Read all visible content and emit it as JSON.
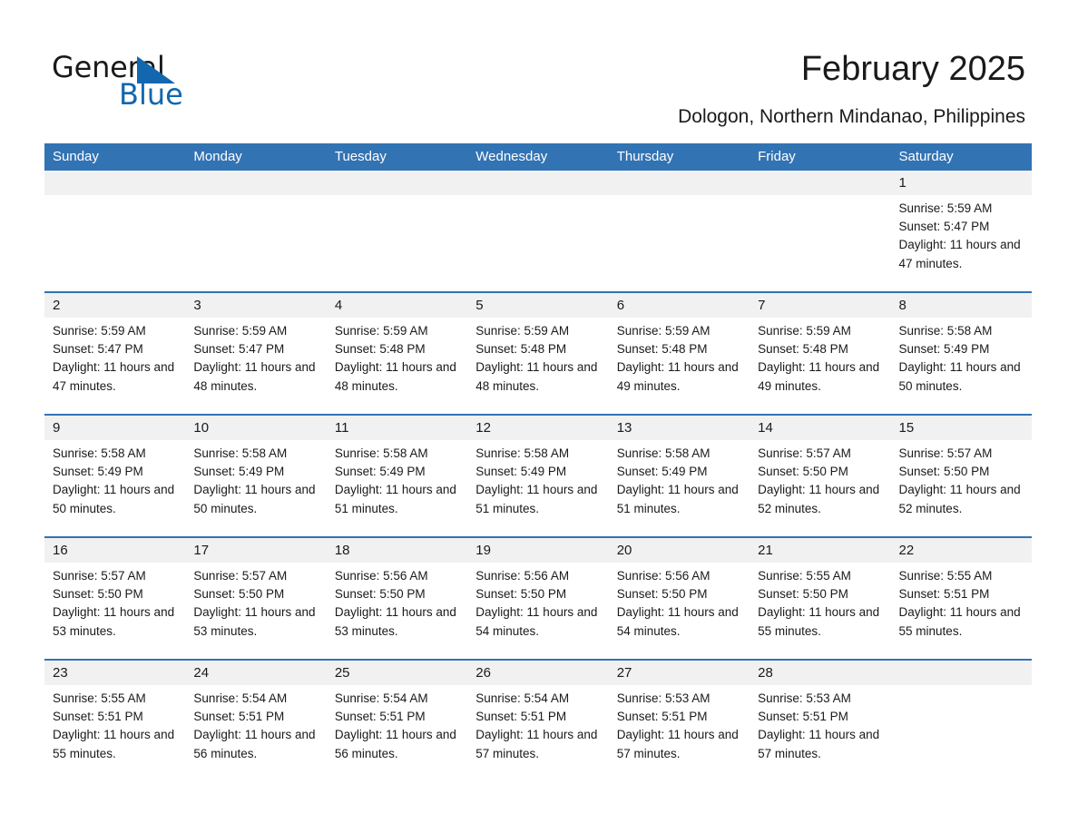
{
  "brand": {
    "name_part1": "General",
    "name_part2": "Blue",
    "accent_color": "#1267ae",
    "logo_icon": "triangle-flag-icon"
  },
  "header": {
    "title": "February 2025",
    "subtitle": "Dologon, Northern Mindanao, Philippines"
  },
  "calendar": {
    "header_bg": "#3273b4",
    "daynum_bg": "#f1f1f1",
    "weekdays": [
      "Sunday",
      "Monday",
      "Tuesday",
      "Wednesday",
      "Thursday",
      "Friday",
      "Saturday"
    ],
    "weeks": [
      [
        {
          "day": "",
          "empty": true
        },
        {
          "day": "",
          "empty": true
        },
        {
          "day": "",
          "empty": true
        },
        {
          "day": "",
          "empty": true
        },
        {
          "day": "",
          "empty": true
        },
        {
          "day": "",
          "empty": true
        },
        {
          "day": "1",
          "sunrise": "Sunrise: 5:59 AM",
          "sunset": "Sunset: 5:47 PM",
          "daylight": "Daylight: 11 hours and 47 minutes."
        }
      ],
      [
        {
          "day": "2",
          "sunrise": "Sunrise: 5:59 AM",
          "sunset": "Sunset: 5:47 PM",
          "daylight": "Daylight: 11 hours and 47 minutes."
        },
        {
          "day": "3",
          "sunrise": "Sunrise: 5:59 AM",
          "sunset": "Sunset: 5:47 PM",
          "daylight": "Daylight: 11 hours and 48 minutes."
        },
        {
          "day": "4",
          "sunrise": "Sunrise: 5:59 AM",
          "sunset": "Sunset: 5:48 PM",
          "daylight": "Daylight: 11 hours and 48 minutes."
        },
        {
          "day": "5",
          "sunrise": "Sunrise: 5:59 AM",
          "sunset": "Sunset: 5:48 PM",
          "daylight": "Daylight: 11 hours and 48 minutes."
        },
        {
          "day": "6",
          "sunrise": "Sunrise: 5:59 AM",
          "sunset": "Sunset: 5:48 PM",
          "daylight": "Daylight: 11 hours and 49 minutes."
        },
        {
          "day": "7",
          "sunrise": "Sunrise: 5:59 AM",
          "sunset": "Sunset: 5:48 PM",
          "daylight": "Daylight: 11 hours and 49 minutes."
        },
        {
          "day": "8",
          "sunrise": "Sunrise: 5:58 AM",
          "sunset": "Sunset: 5:49 PM",
          "daylight": "Daylight: 11 hours and 50 minutes."
        }
      ],
      [
        {
          "day": "9",
          "sunrise": "Sunrise: 5:58 AM",
          "sunset": "Sunset: 5:49 PM",
          "daylight": "Daylight: 11 hours and 50 minutes."
        },
        {
          "day": "10",
          "sunrise": "Sunrise: 5:58 AM",
          "sunset": "Sunset: 5:49 PM",
          "daylight": "Daylight: 11 hours and 50 minutes."
        },
        {
          "day": "11",
          "sunrise": "Sunrise: 5:58 AM",
          "sunset": "Sunset: 5:49 PM",
          "daylight": "Daylight: 11 hours and 51 minutes."
        },
        {
          "day": "12",
          "sunrise": "Sunrise: 5:58 AM",
          "sunset": "Sunset: 5:49 PM",
          "daylight": "Daylight: 11 hours and 51 minutes."
        },
        {
          "day": "13",
          "sunrise": "Sunrise: 5:58 AM",
          "sunset": "Sunset: 5:49 PM",
          "daylight": "Daylight: 11 hours and 51 minutes."
        },
        {
          "day": "14",
          "sunrise": "Sunrise: 5:57 AM",
          "sunset": "Sunset: 5:50 PM",
          "daylight": "Daylight: 11 hours and 52 minutes."
        },
        {
          "day": "15",
          "sunrise": "Sunrise: 5:57 AM",
          "sunset": "Sunset: 5:50 PM",
          "daylight": "Daylight: 11 hours and 52 minutes."
        }
      ],
      [
        {
          "day": "16",
          "sunrise": "Sunrise: 5:57 AM",
          "sunset": "Sunset: 5:50 PM",
          "daylight": "Daylight: 11 hours and 53 minutes."
        },
        {
          "day": "17",
          "sunrise": "Sunrise: 5:57 AM",
          "sunset": "Sunset: 5:50 PM",
          "daylight": "Daylight: 11 hours and 53 minutes."
        },
        {
          "day": "18",
          "sunrise": "Sunrise: 5:56 AM",
          "sunset": "Sunset: 5:50 PM",
          "daylight": "Daylight: 11 hours and 53 minutes."
        },
        {
          "day": "19",
          "sunrise": "Sunrise: 5:56 AM",
          "sunset": "Sunset: 5:50 PM",
          "daylight": "Daylight: 11 hours and 54 minutes."
        },
        {
          "day": "20",
          "sunrise": "Sunrise: 5:56 AM",
          "sunset": "Sunset: 5:50 PM",
          "daylight": "Daylight: 11 hours and 54 minutes."
        },
        {
          "day": "21",
          "sunrise": "Sunrise: 5:55 AM",
          "sunset": "Sunset: 5:50 PM",
          "daylight": "Daylight: 11 hours and 55 minutes."
        },
        {
          "day": "22",
          "sunrise": "Sunrise: 5:55 AM",
          "sunset": "Sunset: 5:51 PM",
          "daylight": "Daylight: 11 hours and 55 minutes."
        }
      ],
      [
        {
          "day": "23",
          "sunrise": "Sunrise: 5:55 AM",
          "sunset": "Sunset: 5:51 PM",
          "daylight": "Daylight: 11 hours and 55 minutes."
        },
        {
          "day": "24",
          "sunrise": "Sunrise: 5:54 AM",
          "sunset": "Sunset: 5:51 PM",
          "daylight": "Daylight: 11 hours and 56 minutes."
        },
        {
          "day": "25",
          "sunrise": "Sunrise: 5:54 AM",
          "sunset": "Sunset: 5:51 PM",
          "daylight": "Daylight: 11 hours and 56 minutes."
        },
        {
          "day": "26",
          "sunrise": "Sunrise: 5:54 AM",
          "sunset": "Sunset: 5:51 PM",
          "daylight": "Daylight: 11 hours and 57 minutes."
        },
        {
          "day": "27",
          "sunrise": "Sunrise: 5:53 AM",
          "sunset": "Sunset: 5:51 PM",
          "daylight": "Daylight: 11 hours and 57 minutes."
        },
        {
          "day": "28",
          "sunrise": "Sunrise: 5:53 AM",
          "sunset": "Sunset: 5:51 PM",
          "daylight": "Daylight: 11 hours and 57 minutes."
        },
        {
          "day": "",
          "empty": true
        }
      ]
    ]
  }
}
